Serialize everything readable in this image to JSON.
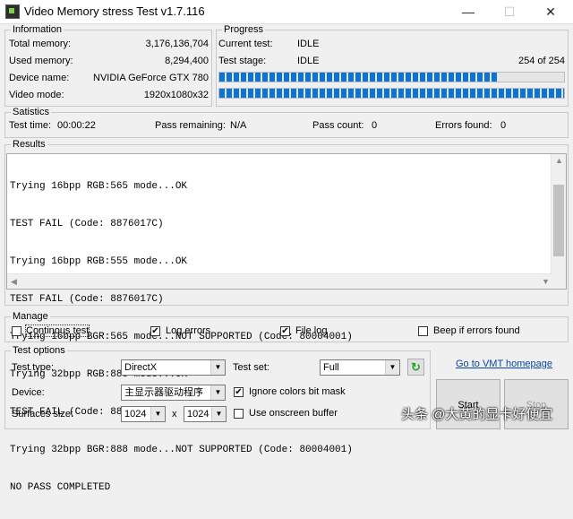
{
  "window": {
    "title": "Video Memory stress Test v1.7.116",
    "minimize": "—",
    "maximize": "☐",
    "close": "✕"
  },
  "information": {
    "title": "Information",
    "rows": [
      {
        "label": "Total memory:",
        "value": "3,176,136,704"
      },
      {
        "label": "Used memory:",
        "value": "8,294,400"
      },
      {
        "label": "Device name:",
        "value": "NVIDIA GeForce GTX 780"
      },
      {
        "label": "Video mode:",
        "value": "1920x1080x32"
      }
    ]
  },
  "progress": {
    "title": "Progress",
    "current_test_label": "Current test:",
    "current_test_value": "IDLE",
    "test_stage_label": "Test stage:",
    "test_stage_value": "IDLE",
    "stage_count": "254 of 254",
    "bar1_fraction": 0.81,
    "bar2_fraction": 1.0
  },
  "statistics": {
    "title": "Satistics",
    "test_time_label": "Test time:",
    "test_time_value": "00:00:22",
    "pass_remaining_label": "Pass remaining:",
    "pass_remaining_value": "N/A",
    "pass_count_label": "Pass count:",
    "pass_count_value": "0",
    "errors_found_label": "Errors found:",
    "errors_found_value": "0"
  },
  "results": {
    "title": "Results",
    "lines": [
      "Trying 16bpp RGB:565 mode...OK",
      "TEST FAIL (Code: 8876017C)",
      "Trying 16bpp RGB:555 mode...OK",
      "TEST FAIL (Code: 8876017C)",
      "Trying 16bpp BGR:565 mode...NOT SUPPORTED (Code: 80004001)",
      "Trying 32bpp RGB:888 mode...OK",
      "TEST FAIL (Code: 8876017C)",
      "Trying 32bpp BGR:888 mode...NOT SUPPORTED (Code: 80004001)",
      "NO PASS COMPLETED"
    ]
  },
  "manage": {
    "title": "Manage",
    "continous_test": {
      "label": "Continous test",
      "checked": false
    },
    "log_errors": {
      "label": "Log errors",
      "checked": true
    },
    "file_log": {
      "label": "File log",
      "checked": true
    },
    "beep": {
      "label": "Beep if errors found",
      "checked": false
    }
  },
  "test_options": {
    "title": "Test options",
    "test_type_label": "Test type:",
    "test_type_value": "DirectX",
    "test_set_label": "Test set:",
    "test_set_value": "Full",
    "device_label": "Device:",
    "device_value": "主显示器驱动程序",
    "ignore_colors": {
      "label": "Ignore colors bit mask",
      "checked": true
    },
    "surfaces_label": "Surfaces size:",
    "surface_w": "1024",
    "surface_x": "x",
    "surface_h": "1024",
    "onscreen": {
      "label": "Use onscreen buffer",
      "checked": false
    }
  },
  "link": "Go to VMT homepage",
  "buttons": {
    "start": "Start",
    "stop": "Stop"
  },
  "watermark": "头条 @大黄的显卡好便宜",
  "colors": {
    "progress_fill": "#0b74d6",
    "link": "#0645ad",
    "refresh_icon": "#2e9e2e"
  },
  "icons": {
    "app": "app-icon",
    "refresh": "refresh-icon"
  }
}
